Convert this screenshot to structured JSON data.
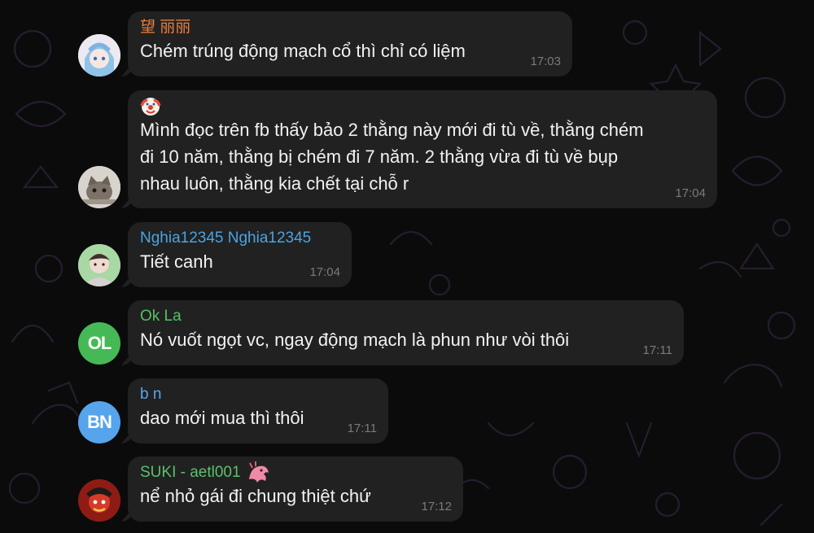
{
  "colors": {
    "background": "#0b0b0c",
    "bubble": "#212121",
    "text": "#f2f2f2",
    "time": "#7a7a7a"
  },
  "messages": [
    {
      "sender": "望 丽丽",
      "sender_color": "#e9803e",
      "avatar": {
        "type": "image",
        "label": ""
      },
      "text": "Chém trúng động mạch cổ thì chỉ có liệm",
      "time": "17:03"
    },
    {
      "sender": "",
      "sender_emoji": "clown-face",
      "avatar": {
        "type": "image",
        "label": ""
      },
      "lines": [
        "Mình đọc trên fb thấy bảo 2 thằng này mới đi tù về, thằng chém",
        "đi 10 năm, thằng bị chém đi 7 năm. 2 thằng vừa đi tù về bụp",
        "nhau luôn, thằng kia chết tại chỗ r"
      ],
      "time": "17:04"
    },
    {
      "sender": "Nghia12345 Nghia12345",
      "sender_color": "#4ba3e2",
      "avatar": {
        "type": "image",
        "label": ""
      },
      "text": "Tiết canh",
      "time": "17:04"
    },
    {
      "sender": "Ok La",
      "sender_color": "#56c163",
      "avatar": {
        "type": "initials",
        "label": "OL",
        "color": "#45b955"
      },
      "text": "Nó vuốt ngọt vc, ngay động mạch là phun như vòi thôi",
      "time": "17:11"
    },
    {
      "sender": "b n",
      "sender_color": "#5aa7ea",
      "avatar": {
        "type": "initials",
        "label": "BN",
        "color": "#55a4ec"
      },
      "text": "dao mới mua thì thôi",
      "time": "17:11"
    },
    {
      "sender": "SUKI - aetl001",
      "sender_color": "#5bc06b",
      "sender_emoji": "dragon-sticker",
      "avatar": {
        "type": "image",
        "label": ""
      },
      "text": "nể nhỏ gái đi chung thiệt chứ",
      "time": "17:12"
    }
  ]
}
